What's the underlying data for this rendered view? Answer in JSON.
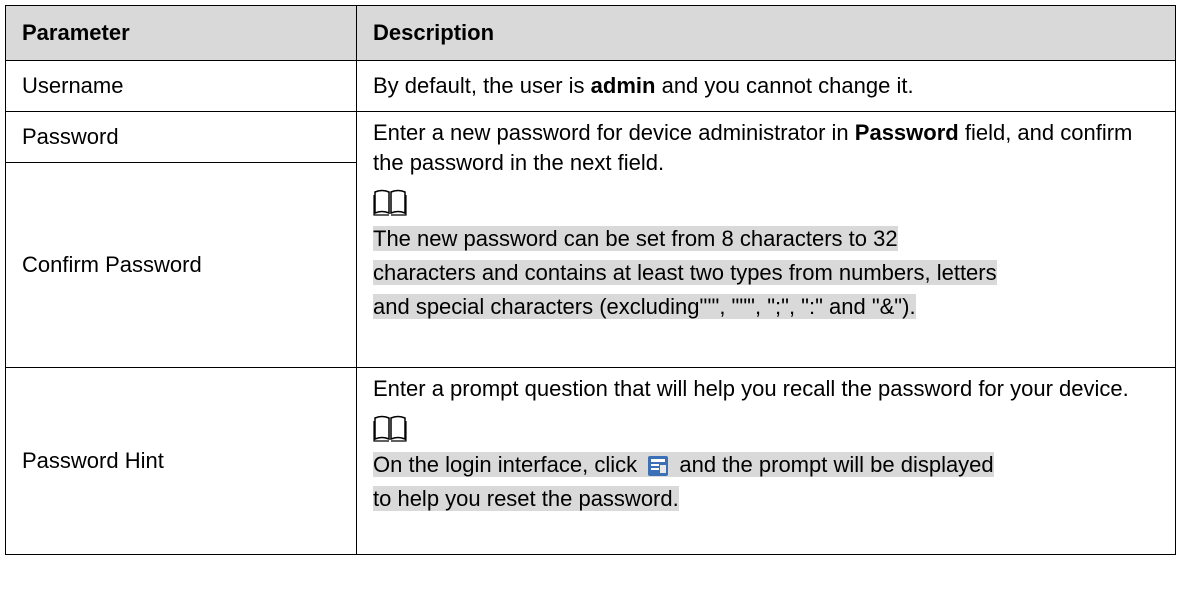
{
  "table": {
    "headers": [
      "Parameter",
      "Description"
    ],
    "rows": [
      {
        "param": "Username",
        "desc_pre": "By default, the user is ",
        "desc_bold": "admin",
        "desc_post": " and you cannot change it."
      },
      {
        "param": "Password",
        "desc_pre": "Enter a new password for device administrator in ",
        "desc_bold": "Password",
        "desc_post": " field, and confirm the password in the next field.",
        "note_icon": "book-icon",
        "note": [
          "The new password can be set from 8 characters to 32 ",
          "characters and contains at least two types from numbers, letters",
          "and special characters (excluding\"'\", \"\"\", \";\", \":\" and \"&\")."
        ]
      },
      {
        "param": "Confirm Password"
      },
      {
        "param": "Password Hint",
        "desc": "Enter a prompt question that will help you recall the password for your device.",
        "note_icon": "book-icon",
        "note_pre": "On the login interface, click ",
        "note_icon_inline": "prompt-icon",
        "note_post1": " and the prompt will be displayed",
        "note_post2": "to help you reset the password."
      }
    ]
  }
}
